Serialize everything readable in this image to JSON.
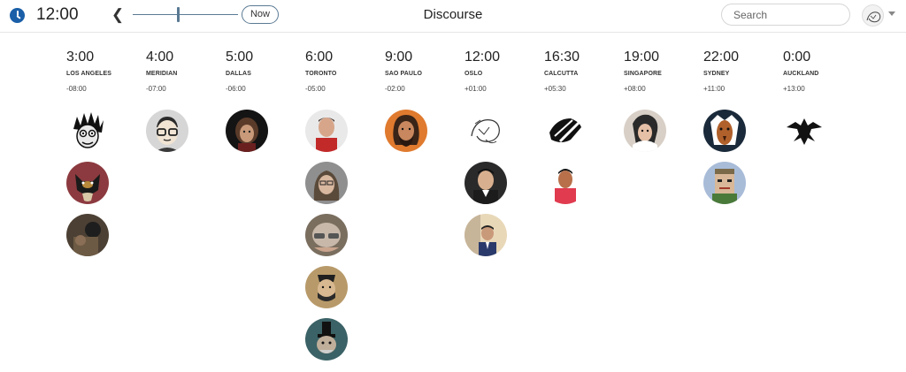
{
  "header": {
    "time": "12:00",
    "back_icon": "chevron-left-icon",
    "now_label": "Now",
    "title": "Discourse",
    "search_placeholder": "Search",
    "clock_icon": "clock-icon",
    "accent_color": "#1a5fa8",
    "slider_position": 0.43
  },
  "zones": [
    {
      "time": "3:00",
      "city": "LOS ANGELES",
      "offset": "-08:00",
      "avatars": 3
    },
    {
      "time": "4:00",
      "city": "MERIDIAN",
      "offset": "-07:00",
      "avatars": 1
    },
    {
      "time": "5:00",
      "city": "DALLAS",
      "offset": "-06:00",
      "avatars": 1
    },
    {
      "time": "6:00",
      "city": "TORONTO",
      "offset": "-05:00",
      "avatars": 5
    },
    {
      "time": "9:00",
      "city": "SAO PAULO",
      "offset": "-02:00",
      "avatars": 1
    },
    {
      "time": "12:00",
      "city": "OSLO",
      "offset": "+01:00",
      "avatars": 3
    },
    {
      "time": "16:30",
      "city": "CALCUTTA",
      "offset": "+05:30",
      "avatars": 2
    },
    {
      "time": "19:00",
      "city": "SINGAPORE",
      "offset": "+08:00",
      "avatars": 1
    },
    {
      "time": "22:00",
      "city": "SYDNEY",
      "offset": "+11:00",
      "avatars": 2
    },
    {
      "time": "0:00",
      "city": "AUCKLAND",
      "offset": "+13:00",
      "avatars": 1
    }
  ]
}
